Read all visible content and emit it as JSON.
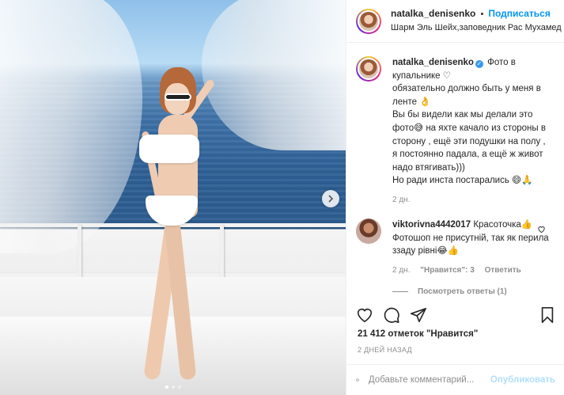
{
  "post": {
    "carousel_slides": 3,
    "carousel_active": 1
  },
  "header": {
    "username": "natalka_denisenko",
    "separator": "•",
    "follow_label": "Подписаться",
    "location": "Шарм Эль Шейх,заповедник Рас Мухамед"
  },
  "caption": {
    "username": "natalka_denisenko",
    "verified": true,
    "text": "Фото в купальнике ♡\nобязательно должно быть у меня в ленте 👌\nВы бы видели как мы делали это фото😅 на яхте качало из стороны в сторону , ещё эти подушки на полу , я постоянно падала, а ещё ж живот надо втягивать)))\nНо ради инста постарались 😄🙏",
    "time": "2 дн."
  },
  "comment": {
    "username": "viktorivna4442017",
    "text": "Красоточка👍 Фотошоп не присутній, так як перила ззаду рівні😂👍",
    "time": "2 дн.",
    "likes": "\"Нравится\": 3",
    "reply_label": "Ответить",
    "view_replies": "Посмотреть ответы (1)"
  },
  "stats": {
    "likes": "21 412 отметок \"Нравится\"",
    "date": "2 ДНЕЙ НАЗАД"
  },
  "add_comment": {
    "placeholder": "Добавьте комментарий...",
    "publish_label": "Опубликовать"
  },
  "icons": {
    "like": "heart-icon",
    "comment": "comment-bubble-icon",
    "share": "paper-plane-icon",
    "save": "bookmark-icon",
    "emoji": "smiley-icon",
    "next": "chevron-right-icon"
  },
  "colors": {
    "accent": "#0095f6",
    "publish_disabled": "#b2dffc",
    "muted": "#8e8e8e",
    "text": "#262626"
  }
}
